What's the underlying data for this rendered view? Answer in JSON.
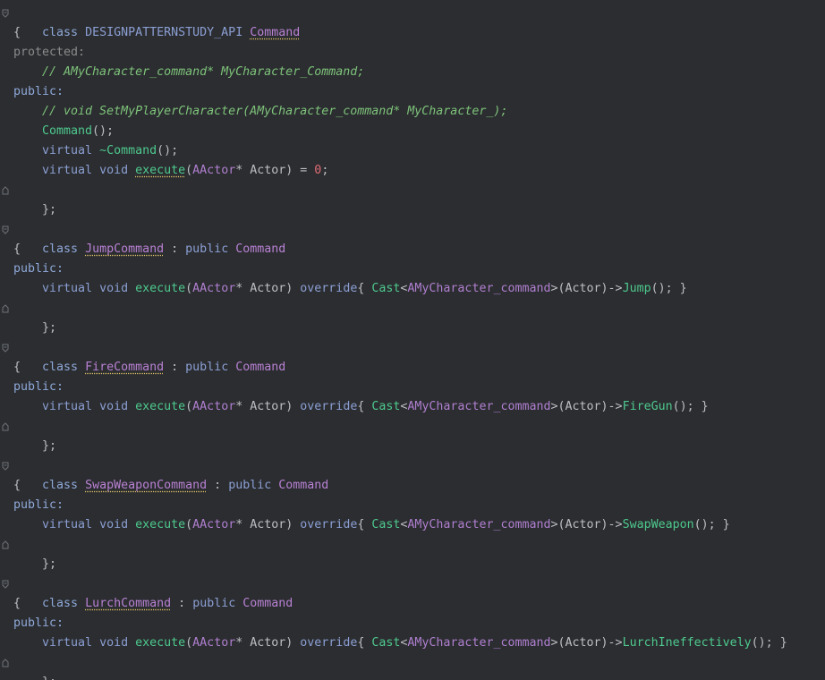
{
  "code": {
    "line1": {
      "kw_class": "class",
      "api": "DESIGNPATTERNSTUDY_API",
      "name": "Command"
    },
    "brace_open": "{",
    "protected": "protected:",
    "comment1": "// AMyCharacter_command* MyCharacter_Command;",
    "public": "public:",
    "comment2": "// void SetMyPlayerCharacter(AMyCharacter_command* MyCharacter_);",
    "ctor": "Command",
    "ctor_rest": "();",
    "virtual": "virtual",
    "dtor": "~Command",
    "void": "void",
    "execute": "execute",
    "aactor": "AActor",
    "star_actor": "* Actor)",
    "paren_open": "(",
    "eq": " = ",
    "zero": "0",
    "semi": ";",
    "brace_close": "};",
    "colon_public": " : ",
    "kw_public": "public",
    "override": "override",
    "cast": "Cast",
    "lt": "<",
    "char_cmd": "AMyCharacter_command",
    "gt_actor": ">(Actor)->",
    "call_end": "(); }",
    "brace_lbrace": "{ ",
    "classes": [
      {
        "name": "JumpCommand",
        "base": "Command",
        "method": "Jump"
      },
      {
        "name": "FireCommand",
        "base": "Command",
        "method": "FireGun"
      },
      {
        "name": "SwapWeaponCommand",
        "base": "Command",
        "method": "SwapWeapon"
      },
      {
        "name": "LurchCommand",
        "base": "Command",
        "method": "LurchIneffectively"
      }
    ]
  },
  "colors": {
    "background": "#2b2d30",
    "keyword": "#8fa8d9",
    "comment": "#7ec27a",
    "type": "#b981d4",
    "method": "#4ec98e",
    "number": "#e06c75"
  }
}
